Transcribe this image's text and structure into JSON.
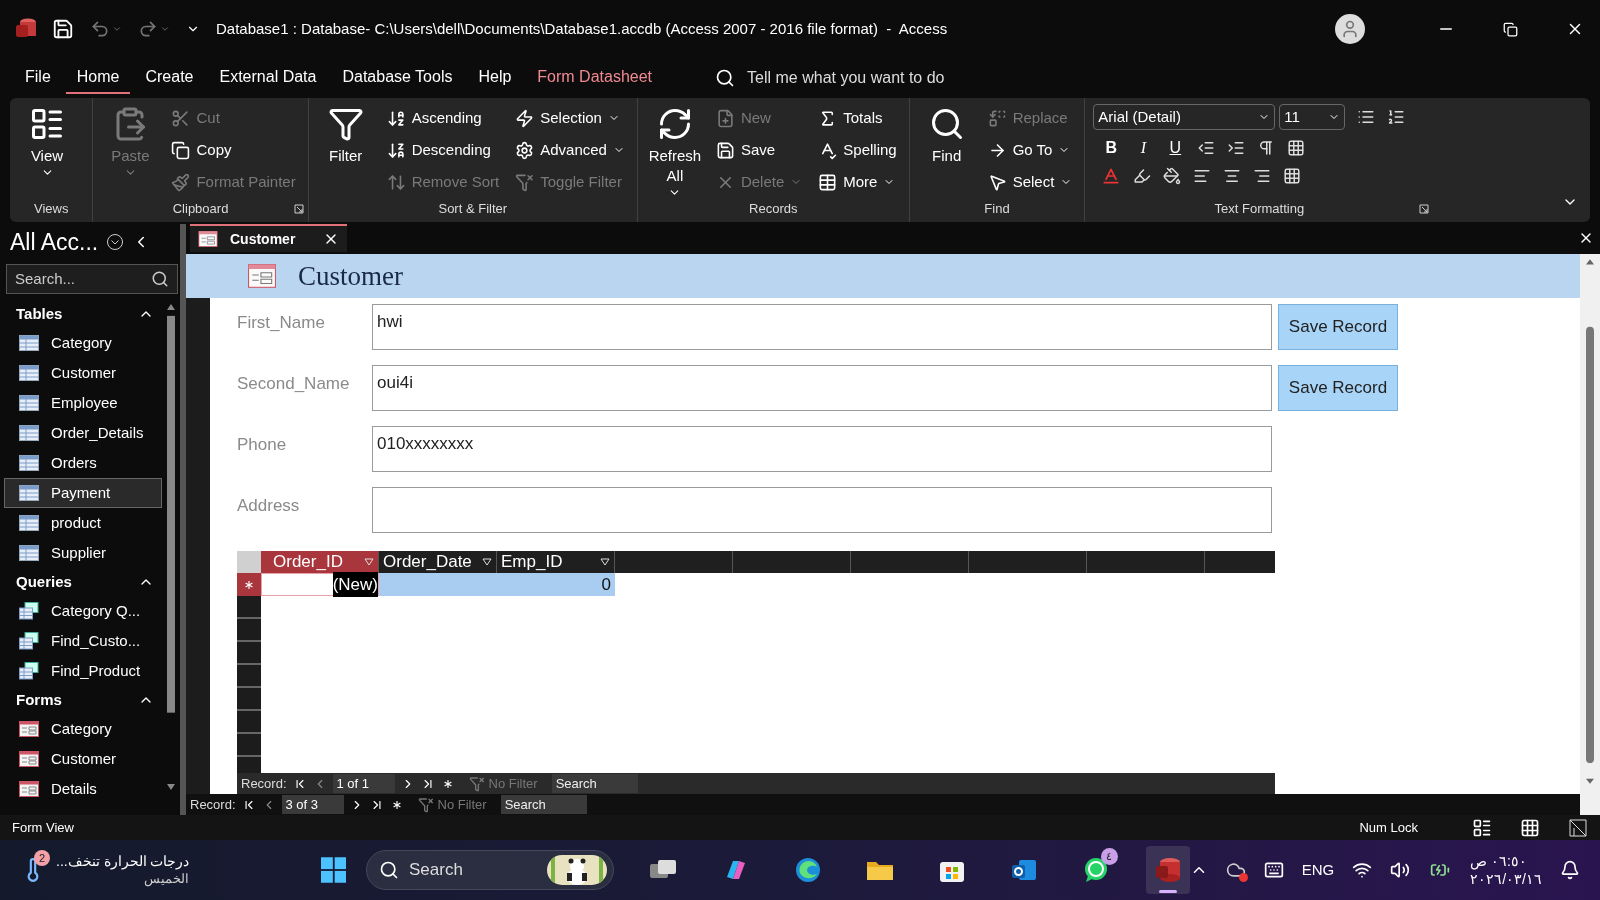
{
  "window": {
    "title": "Database1 : Database- C:\\Users\\dell\\Documents\\Database1.accdb (Access 2007 - 2016 file format)  -  Access"
  },
  "menu_tabs": [
    {
      "label": "File",
      "selected": false,
      "contextual": false
    },
    {
      "label": "Home",
      "selected": true,
      "contextual": false
    },
    {
      "label": "Create",
      "selected": false,
      "contextual": false
    },
    {
      "label": "External Data",
      "selected": false,
      "contextual": false
    },
    {
      "label": "Database Tools",
      "selected": false,
      "contextual": false
    },
    {
      "label": "Help",
      "selected": false,
      "contextual": false
    },
    {
      "label": "Form Datasheet",
      "selected": false,
      "contextual": true
    }
  ],
  "tell_me": {
    "placeholder": "Tell me what you want to do"
  },
  "ribbon_groups": [
    {
      "label": "Views",
      "large": [
        {
          "label": "View",
          "disabled": false,
          "dropdown": true
        }
      ]
    },
    {
      "label": "Clipboard",
      "launcher": true,
      "large": [
        {
          "label": "Paste",
          "disabled": true,
          "dropdown": true
        }
      ],
      "columns": [
        [
          {
            "label": "Cut",
            "disabled": true,
            "dropdown": false
          },
          {
            "label": "Copy",
            "disabled": false,
            "dropdown": false
          },
          {
            "label": "Format Painter",
            "disabled": true,
            "dropdown": false
          }
        ]
      ]
    },
    {
      "label": "Sort & Filter",
      "large": [
        {
          "label": "Filter",
          "disabled": false,
          "dropdown": false
        }
      ],
      "columns": [
        [
          {
            "label": "Ascending",
            "disabled": false,
            "dropdown": false
          },
          {
            "label": "Descending",
            "disabled": false,
            "dropdown": false
          },
          {
            "label": "Remove Sort",
            "disabled": true,
            "dropdown": false
          }
        ],
        [
          {
            "label": "Selection",
            "disabled": false,
            "dropdown": true
          },
          {
            "label": "Advanced",
            "disabled": false,
            "dropdown": true
          },
          {
            "label": "Toggle Filter",
            "disabled": true,
            "dropdown": false
          }
        ]
      ]
    },
    {
      "label": "Records",
      "large": [
        {
          "label": "Refresh All",
          "disabled": false,
          "dropdown": true
        }
      ],
      "columns": [
        [
          {
            "label": "New",
            "disabled": true,
            "dropdown": false
          },
          {
            "label": "Save",
            "disabled": false,
            "dropdown": false
          },
          {
            "label": "Delete",
            "disabled": true,
            "dropdown": true
          }
        ],
        [
          {
            "label": "Totals",
            "disabled": false,
            "dropdown": false
          },
          {
            "label": "Spelling",
            "disabled": false,
            "dropdown": false
          },
          {
            "label": "More",
            "disabled": false,
            "dropdown": true
          }
        ]
      ]
    },
    {
      "label": "Find",
      "large": [
        {
          "label": "Find",
          "disabled": false,
          "dropdown": false
        }
      ],
      "columns": [
        [
          {
            "label": "Replace",
            "disabled": true,
            "dropdown": false
          },
          {
            "label": "Go To",
            "disabled": false,
            "dropdown": true
          },
          {
            "label": "Select",
            "disabled": false,
            "dropdown": true
          }
        ]
      ]
    }
  ],
  "text_formatting": {
    "label": "Text Formatting",
    "launcher": true,
    "font": "Arial (Detail)",
    "size": "11",
    "style_buttons": [
      "B",
      "I",
      "U"
    ]
  },
  "navigation": {
    "title": "All Acc...",
    "search": {
      "placeholder": "Search..."
    },
    "sections": [
      {
        "title": "Tables",
        "kind": "table",
        "expanded": true,
        "items": [
          {
            "label": "Category",
            "selected": false
          },
          {
            "label": "Customer",
            "selected": false
          },
          {
            "label": "Employee",
            "selected": false
          },
          {
            "label": "Order_Details",
            "selected": false
          },
          {
            "label": "Orders",
            "selected": false
          },
          {
            "label": "Payment",
            "selected": true
          },
          {
            "label": "product",
            "selected": false
          },
          {
            "label": "Supplier",
            "selected": false
          }
        ]
      },
      {
        "title": "Queries",
        "kind": "query",
        "expanded": true,
        "items": [
          {
            "label": "Category Q...",
            "selected": false
          },
          {
            "label": "Find_Custo...",
            "selected": false
          },
          {
            "label": "Find_Product",
            "selected": false
          }
        ]
      },
      {
        "title": "Forms",
        "kind": "form",
        "expanded": true,
        "items": [
          {
            "label": "Category",
            "selected": false
          },
          {
            "label": "Customer",
            "selected": false
          },
          {
            "label": "Details",
            "selected": false
          }
        ]
      }
    ]
  },
  "document_tab": {
    "label": "Customer"
  },
  "form": {
    "title": "Customer",
    "fields": [
      {
        "label": "First_Name",
        "value": "hwi",
        "button": "Save Record"
      },
      {
        "label": "Second_Name",
        "value": "oui4i",
        "button": "Save Record"
      },
      {
        "label": "Phone",
        "value": "010xxxxxxxx"
      },
      {
        "label": "Address"
      }
    ],
    "subform": {
      "columns": [
        {
          "label": "Order_ID",
          "selected": true,
          "new_row_value": "(New)"
        },
        {
          "label": "Order_Date",
          "selected": false
        },
        {
          "label": "Emp_ID",
          "selected": false,
          "new_row_value": "0"
        }
      ],
      "navigation": {
        "label": "Record:",
        "position": "1 of 1",
        "filter": "No Filter",
        "search": "Search"
      }
    },
    "navigation": {
      "label": "Record:",
      "position": "3 of 3",
      "filter": "No Filter",
      "search": "Search"
    }
  },
  "status_bar": {
    "mode": "Form View",
    "num_lock": "Num Lock"
  },
  "taskbar": {
    "weather": {
      "text": "درجات الحرارة تنخف...",
      "day": "الخميس",
      "badge": "2"
    },
    "search": {
      "placeholder": "Search"
    },
    "apps": [
      {
        "kind": "task-view",
        "active": false
      },
      {
        "kind": "copilot",
        "active": false
      },
      {
        "kind": "edge",
        "active": false
      },
      {
        "kind": "explorer",
        "active": false
      },
      {
        "kind": "store",
        "active": false
      },
      {
        "kind": "outlook",
        "active": false
      },
      {
        "kind": "whatsapp",
        "active": false,
        "badge": "٤"
      },
      {
        "kind": "access",
        "active": true
      }
    ],
    "language": "ENG",
    "time": "٠٦:٥٠ ص",
    "date": "٢٠٢٦/٠٣/١٦"
  }
}
